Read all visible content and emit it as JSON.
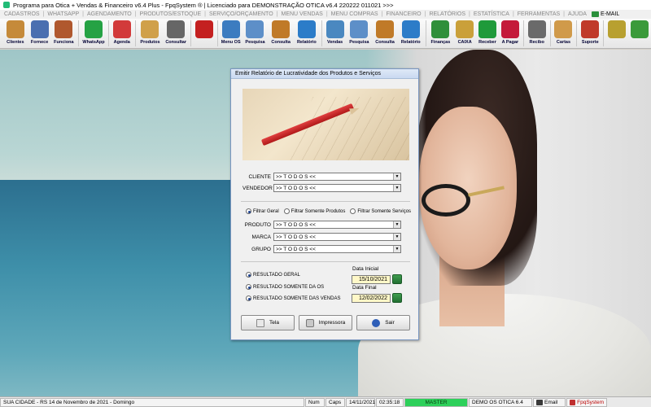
{
  "window": {
    "title": "Programa para Otica + Vendas & Financeiro v6.4 Plus - FpqSystem ® | Licenciado para  DEMONSTRAÇÃO OTICA v6.4 220222 011021 >>>"
  },
  "menu": {
    "items": [
      "CADASTROS",
      "WHATSAPP",
      "AGENDAMENTO",
      "PRODUTOS/ESTOQUE",
      "SERVIÇO/ORÇAMENTO",
      "MENU VENDAS",
      "MENU COMPRAS",
      "FINANCEIRO",
      "RELATÓRIOS",
      "ESTATÍSTICA",
      "FERRAMENTAS",
      "AJUDA"
    ],
    "email_label": "E-MAIL"
  },
  "toolbar": {
    "buttons": [
      {
        "label": "Clientes",
        "icon": "users-icon",
        "color": "#c58a3a"
      },
      {
        "label": "Fornece",
        "icon": "supplier-icon",
        "color": "#4a6fb0"
      },
      {
        "label": "Funciona",
        "icon": "employee-icon",
        "color": "#b0582e"
      },
      {
        "label": "WhatsApp",
        "icon": "whatsapp-icon",
        "color": "#25a244"
      },
      {
        "label": "Agenda",
        "icon": "calendar-icon",
        "color": "#d23a3a"
      },
      {
        "label": "Produtos",
        "icon": "boxes-icon",
        "color": "#d0a04a"
      },
      {
        "label": "Consultar",
        "icon": "barcode-icon",
        "color": "#666666"
      },
      {
        "label": "",
        "icon": "plus-tag-icon",
        "color": "#c42020"
      },
      {
        "label": "Menu OS",
        "icon": "form-icon",
        "color": "#3c7cc0"
      },
      {
        "label": "Pesquisa",
        "icon": "search-doc-icon",
        "color": "#5d8fc8"
      },
      {
        "label": "Consulta",
        "icon": "folder-icon",
        "color": "#c07a28"
      },
      {
        "label": "Relatório",
        "icon": "report-chart-icon",
        "color": "#2c7cc8"
      },
      {
        "label": "Vendas",
        "icon": "monitor-icon",
        "color": "#4a88c0"
      },
      {
        "label": "Pesquisa",
        "icon": "search-doc-icon",
        "color": "#5d8fc8"
      },
      {
        "label": "Consulta",
        "icon": "folder-icon",
        "color": "#c07a28"
      },
      {
        "label": "Relatório",
        "icon": "report-chart-icon",
        "color": "#2c7cc8"
      },
      {
        "label": "Finanças",
        "icon": "finance-icon",
        "color": "#2f8f3a"
      },
      {
        "label": "CAIXA",
        "icon": "cashbox-icon",
        "color": "#caa03a"
      },
      {
        "label": "Receber",
        "icon": "dollar-green-icon",
        "color": "#1f9a3a"
      },
      {
        "label": "A Pagar",
        "icon": "dollar-red-icon",
        "color": "#c41a3a"
      },
      {
        "label": "Recibo",
        "icon": "receipt-icon",
        "color": "#6a6a6a"
      },
      {
        "label": "Cartas",
        "icon": "letters-icon",
        "color": "#d09a4a"
      },
      {
        "label": "Suporte",
        "icon": "support-icon",
        "color": "#c03a2a"
      },
      {
        "label": "",
        "icon": "coin-icon",
        "color": "#b8a030"
      },
      {
        "label": "",
        "icon": "exit-icon",
        "color": "#3a9a3a"
      }
    ]
  },
  "dialog": {
    "title": "Emitir Relatório de Lucratividade dos Produtos e Serviços",
    "cliente_label": "CLIENTE",
    "cliente_value": ">> T O D O S <<",
    "vendedor_label": "VENDEDOR",
    "vendedor_value": ">> T O D O S <<",
    "filter_options": [
      "Filtrar Geral",
      "Filtrar Somente Produtos",
      "Filtrar Somente Serviços"
    ],
    "filter_selected": 0,
    "produto_label": "PRODUTO",
    "produto_value": ">> T O D O S <<",
    "marca_label": "MARCA",
    "marca_value": ">> T O D O S <<",
    "grupo_label": "GRUPO",
    "grupo_value": ">> T O D O S <<",
    "result_options": [
      "RESULTADO GERAL",
      "RESULTADO SOMENTE DA OS",
      "RESULTADO SOMENTE DAS VENDAS"
    ],
    "data_inicial_label": "Data Inicial",
    "data_inicial_value": "15/10/2021",
    "data_final_label": "Data Final",
    "data_final_value": "12/02/2022",
    "btn_tela": "Tela",
    "btn_impressora": "Impressora",
    "btn_sair": "Sair"
  },
  "status": {
    "city_date": "SUA CIDADE - RS 14 de Novembro de 2021 - Domingo",
    "num": "Num",
    "caps": "Caps",
    "date": "14/11/2021",
    "time": "02:35:18",
    "master": "MASTER",
    "company": "DEMO OS OTICA 6.4",
    "email": "Email",
    "brand": "FpqSystem"
  }
}
